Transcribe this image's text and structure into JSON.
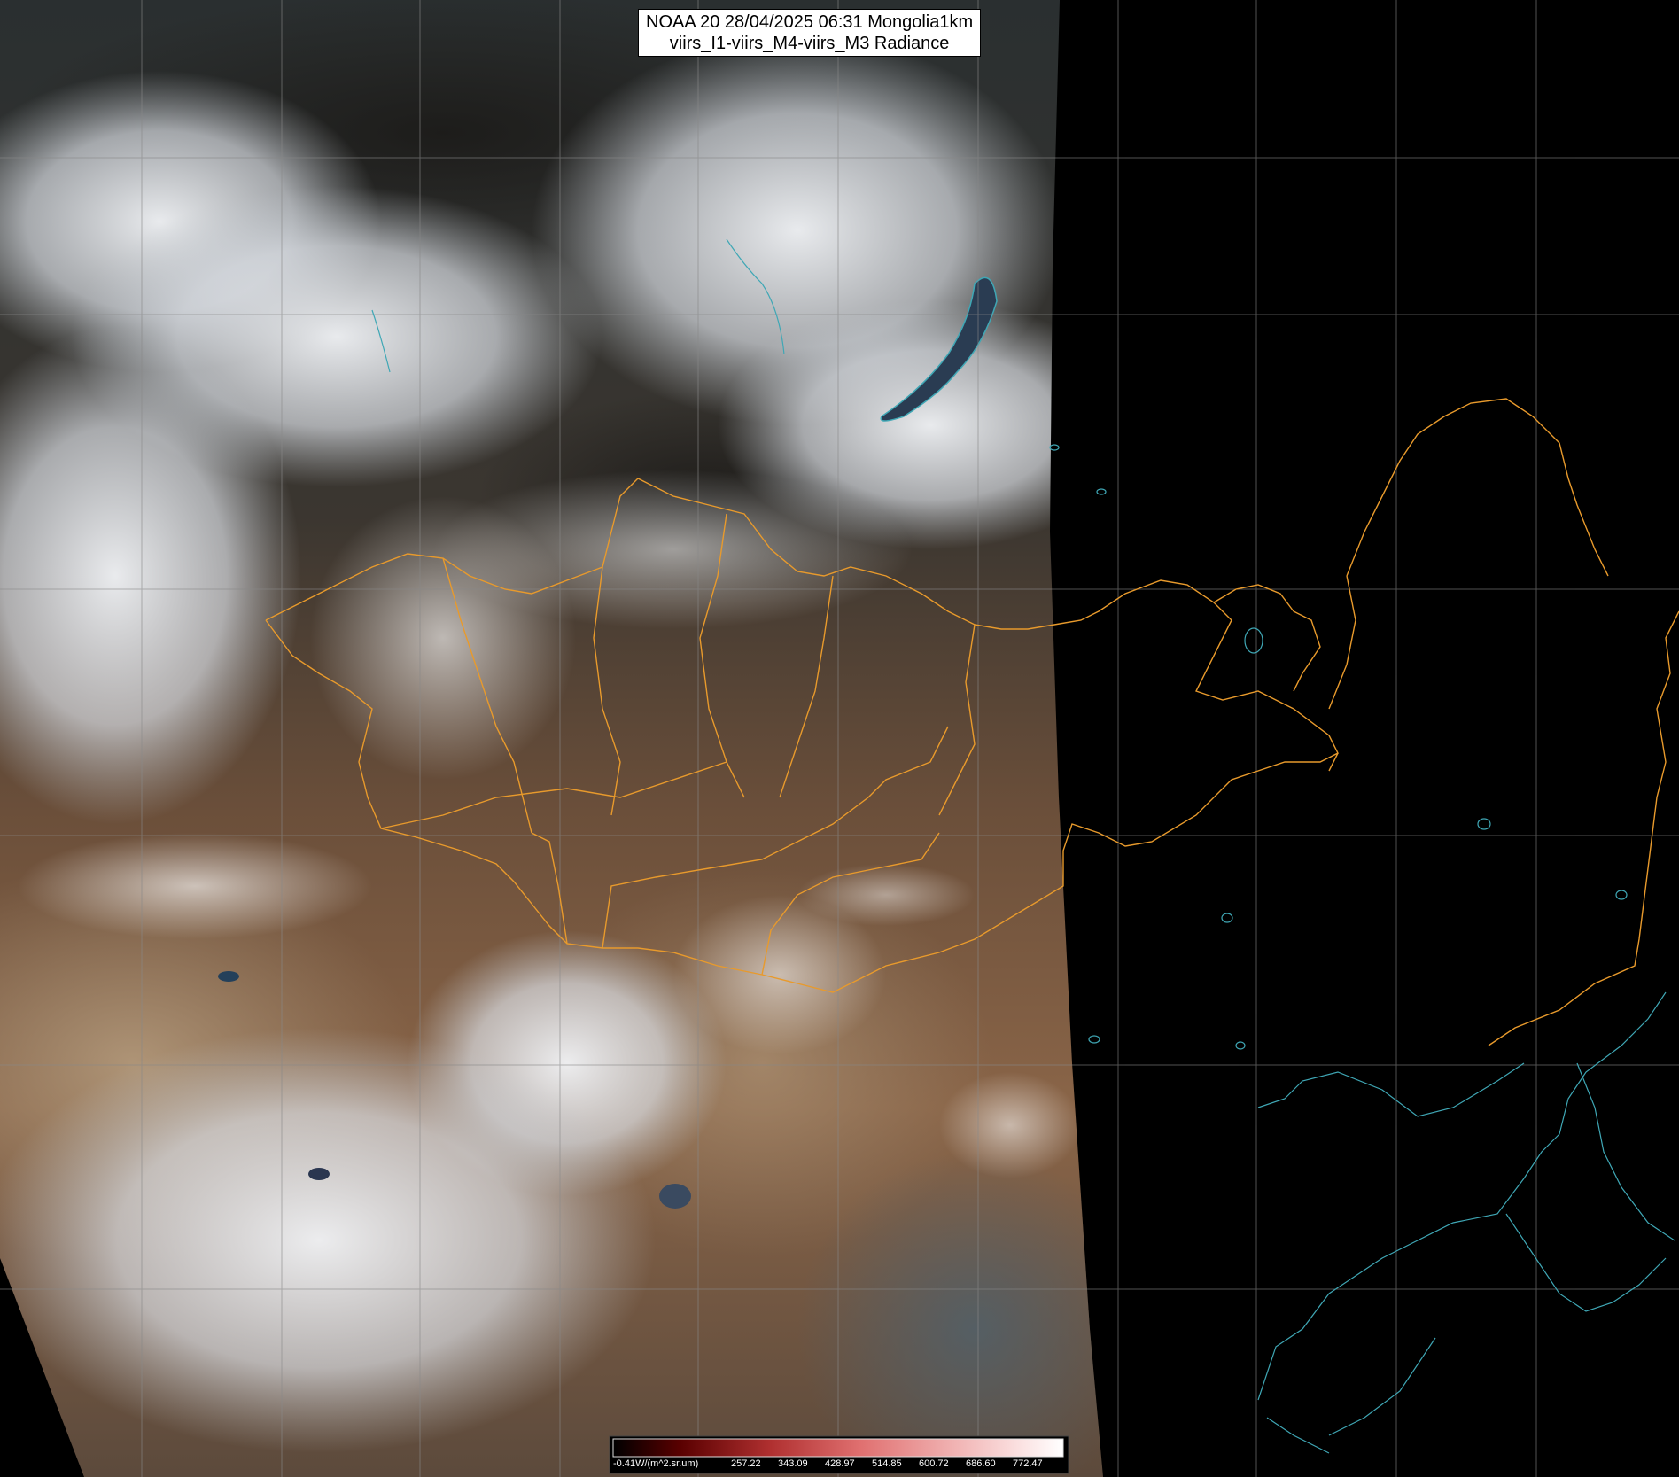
{
  "title": {
    "line1": "NOAA 20 28/04/2025 06:31 Mongolia1km",
    "line2": "viirs_I1-viirs_M4-viirs_M3 Radiance"
  },
  "colors": {
    "border_lines": "#e89a2c",
    "coastline": "#3fa7b5",
    "grid": "#888888",
    "background": "#000000"
  },
  "legend": {
    "ticks": [
      "-0.41W/(m^2.sr.um)",
      "257.22",
      "343.09",
      "428.97",
      "514.85",
      "600.72",
      "686.60",
      "772.47"
    ]
  }
}
